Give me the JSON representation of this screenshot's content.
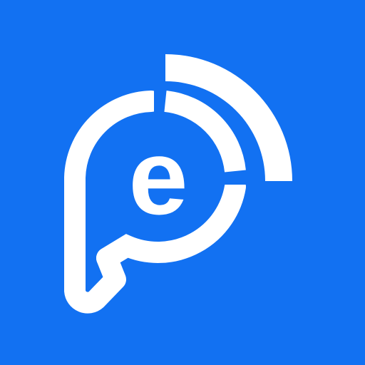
{
  "app_icon": {
    "name": "app-logo",
    "background_color": "#1271F2",
    "foreground_color": "#FFFFFF",
    "letter": "e",
    "icon_semantics": "speech-bubble-with-signal-waves"
  }
}
